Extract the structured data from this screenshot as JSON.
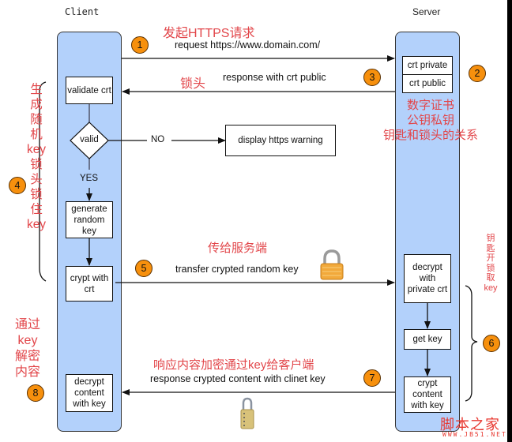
{
  "lanes": {
    "client": {
      "title": "Client"
    },
    "server": {
      "title": "Server"
    }
  },
  "client_boxes": {
    "validate": "validate crt",
    "valid_decision": "valid",
    "generate": "generate random key",
    "crypt": "crypt with crt",
    "decrypt": "decrypt content with key"
  },
  "decision": {
    "yes_label": "YES",
    "no_label": "NO"
  },
  "warning_box": "display https warning",
  "server_boxes": {
    "crt_private": "crt private",
    "crt_public": "crt public",
    "decrypt_private": "decrypt with private crt",
    "get_key": "get key",
    "crypt_content": "crypt content with key"
  },
  "steps": [
    {
      "number": "1",
      "message": "request https://www.domain.com/",
      "annotation": "发起HTTPS请求"
    },
    {
      "number": "2",
      "annotation_lines": [
        "数字证书",
        "公钥私钥",
        "钥匙和锁头的关系"
      ]
    },
    {
      "number": "3",
      "message": "response with crt public",
      "annotation": "锁头"
    },
    {
      "number": "4",
      "annotation_vertical": [
        "生",
        "成",
        "随",
        "机",
        "key",
        "锁",
        "头",
        "锁",
        "住",
        "key"
      ]
    },
    {
      "number": "5",
      "message": "transfer crypted random key",
      "annotation": "传给服务端"
    },
    {
      "number": "6",
      "annotation_vertical": [
        "钥",
        "匙",
        "开",
        "锁",
        "取",
        "key"
      ]
    },
    {
      "number": "7",
      "message": "response crypted content with clinet key",
      "annotation": "响应内容加密通过key给客户端"
    },
    {
      "number": "8",
      "annotation_vertical": [
        "通过",
        "key",
        "解密",
        "内容"
      ]
    }
  ],
  "icons": {
    "padlock_gold": "padlock-icon",
    "combination_lock": "combination-lock-icon"
  },
  "watermark": {
    "title": "脚本之家",
    "url": "WWW.JB51.NET"
  },
  "colors": {
    "lane": "#b3d1fb",
    "badge": "#f7900d",
    "annotation": "#e2464a"
  }
}
